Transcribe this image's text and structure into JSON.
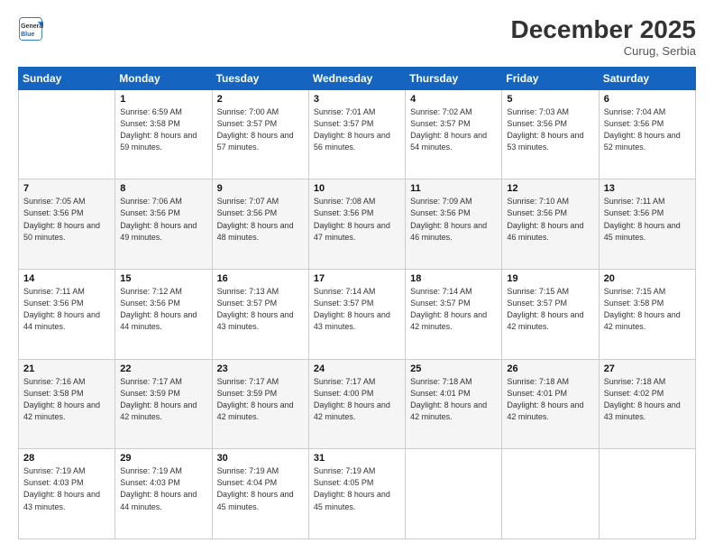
{
  "header": {
    "logo_line1": "General",
    "logo_line2": "Blue",
    "month": "December 2025",
    "location": "Curug, Serbia"
  },
  "weekdays": [
    "Sunday",
    "Monday",
    "Tuesday",
    "Wednesday",
    "Thursday",
    "Friday",
    "Saturday"
  ],
  "weeks": [
    [
      {
        "day": "",
        "sunrise": "",
        "sunset": "",
        "daylight": ""
      },
      {
        "day": "1",
        "sunrise": "Sunrise: 6:59 AM",
        "sunset": "Sunset: 3:58 PM",
        "daylight": "Daylight: 8 hours and 59 minutes."
      },
      {
        "day": "2",
        "sunrise": "Sunrise: 7:00 AM",
        "sunset": "Sunset: 3:57 PM",
        "daylight": "Daylight: 8 hours and 57 minutes."
      },
      {
        "day": "3",
        "sunrise": "Sunrise: 7:01 AM",
        "sunset": "Sunset: 3:57 PM",
        "daylight": "Daylight: 8 hours and 56 minutes."
      },
      {
        "day": "4",
        "sunrise": "Sunrise: 7:02 AM",
        "sunset": "Sunset: 3:57 PM",
        "daylight": "Daylight: 8 hours and 54 minutes."
      },
      {
        "day": "5",
        "sunrise": "Sunrise: 7:03 AM",
        "sunset": "Sunset: 3:56 PM",
        "daylight": "Daylight: 8 hours and 53 minutes."
      },
      {
        "day": "6",
        "sunrise": "Sunrise: 7:04 AM",
        "sunset": "Sunset: 3:56 PM",
        "daylight": "Daylight: 8 hours and 52 minutes."
      }
    ],
    [
      {
        "day": "7",
        "sunrise": "Sunrise: 7:05 AM",
        "sunset": "Sunset: 3:56 PM",
        "daylight": "Daylight: 8 hours and 50 minutes."
      },
      {
        "day": "8",
        "sunrise": "Sunrise: 7:06 AM",
        "sunset": "Sunset: 3:56 PM",
        "daylight": "Daylight: 8 hours and 49 minutes."
      },
      {
        "day": "9",
        "sunrise": "Sunrise: 7:07 AM",
        "sunset": "Sunset: 3:56 PM",
        "daylight": "Daylight: 8 hours and 48 minutes."
      },
      {
        "day": "10",
        "sunrise": "Sunrise: 7:08 AM",
        "sunset": "Sunset: 3:56 PM",
        "daylight": "Daylight: 8 hours and 47 minutes."
      },
      {
        "day": "11",
        "sunrise": "Sunrise: 7:09 AM",
        "sunset": "Sunset: 3:56 PM",
        "daylight": "Daylight: 8 hours and 46 minutes."
      },
      {
        "day": "12",
        "sunrise": "Sunrise: 7:10 AM",
        "sunset": "Sunset: 3:56 PM",
        "daylight": "Daylight: 8 hours and 46 minutes."
      },
      {
        "day": "13",
        "sunrise": "Sunrise: 7:11 AM",
        "sunset": "Sunset: 3:56 PM",
        "daylight": "Daylight: 8 hours and 45 minutes."
      }
    ],
    [
      {
        "day": "14",
        "sunrise": "Sunrise: 7:11 AM",
        "sunset": "Sunset: 3:56 PM",
        "daylight": "Daylight: 8 hours and 44 minutes."
      },
      {
        "day": "15",
        "sunrise": "Sunrise: 7:12 AM",
        "sunset": "Sunset: 3:56 PM",
        "daylight": "Daylight: 8 hours and 44 minutes."
      },
      {
        "day": "16",
        "sunrise": "Sunrise: 7:13 AM",
        "sunset": "Sunset: 3:57 PM",
        "daylight": "Daylight: 8 hours and 43 minutes."
      },
      {
        "day": "17",
        "sunrise": "Sunrise: 7:14 AM",
        "sunset": "Sunset: 3:57 PM",
        "daylight": "Daylight: 8 hours and 43 minutes."
      },
      {
        "day": "18",
        "sunrise": "Sunrise: 7:14 AM",
        "sunset": "Sunset: 3:57 PM",
        "daylight": "Daylight: 8 hours and 42 minutes."
      },
      {
        "day": "19",
        "sunrise": "Sunrise: 7:15 AM",
        "sunset": "Sunset: 3:57 PM",
        "daylight": "Daylight: 8 hours and 42 minutes."
      },
      {
        "day": "20",
        "sunrise": "Sunrise: 7:15 AM",
        "sunset": "Sunset: 3:58 PM",
        "daylight": "Daylight: 8 hours and 42 minutes."
      }
    ],
    [
      {
        "day": "21",
        "sunrise": "Sunrise: 7:16 AM",
        "sunset": "Sunset: 3:58 PM",
        "daylight": "Daylight: 8 hours and 42 minutes."
      },
      {
        "day": "22",
        "sunrise": "Sunrise: 7:17 AM",
        "sunset": "Sunset: 3:59 PM",
        "daylight": "Daylight: 8 hours and 42 minutes."
      },
      {
        "day": "23",
        "sunrise": "Sunrise: 7:17 AM",
        "sunset": "Sunset: 3:59 PM",
        "daylight": "Daylight: 8 hours and 42 minutes."
      },
      {
        "day": "24",
        "sunrise": "Sunrise: 7:17 AM",
        "sunset": "Sunset: 4:00 PM",
        "daylight": "Daylight: 8 hours and 42 minutes."
      },
      {
        "day": "25",
        "sunrise": "Sunrise: 7:18 AM",
        "sunset": "Sunset: 4:01 PM",
        "daylight": "Daylight: 8 hours and 42 minutes."
      },
      {
        "day": "26",
        "sunrise": "Sunrise: 7:18 AM",
        "sunset": "Sunset: 4:01 PM",
        "daylight": "Daylight: 8 hours and 42 minutes."
      },
      {
        "day": "27",
        "sunrise": "Sunrise: 7:18 AM",
        "sunset": "Sunset: 4:02 PM",
        "daylight": "Daylight: 8 hours and 43 minutes."
      }
    ],
    [
      {
        "day": "28",
        "sunrise": "Sunrise: 7:19 AM",
        "sunset": "Sunset: 4:03 PM",
        "daylight": "Daylight: 8 hours and 43 minutes."
      },
      {
        "day": "29",
        "sunrise": "Sunrise: 7:19 AM",
        "sunset": "Sunset: 4:03 PM",
        "daylight": "Daylight: 8 hours and 44 minutes."
      },
      {
        "day": "30",
        "sunrise": "Sunrise: 7:19 AM",
        "sunset": "Sunset: 4:04 PM",
        "daylight": "Daylight: 8 hours and 45 minutes."
      },
      {
        "day": "31",
        "sunrise": "Sunrise: 7:19 AM",
        "sunset": "Sunset: 4:05 PM",
        "daylight": "Daylight: 8 hours and 45 minutes."
      },
      {
        "day": "",
        "sunrise": "",
        "sunset": "",
        "daylight": ""
      },
      {
        "day": "",
        "sunrise": "",
        "sunset": "",
        "daylight": ""
      },
      {
        "day": "",
        "sunrise": "",
        "sunset": "",
        "daylight": ""
      }
    ]
  ]
}
